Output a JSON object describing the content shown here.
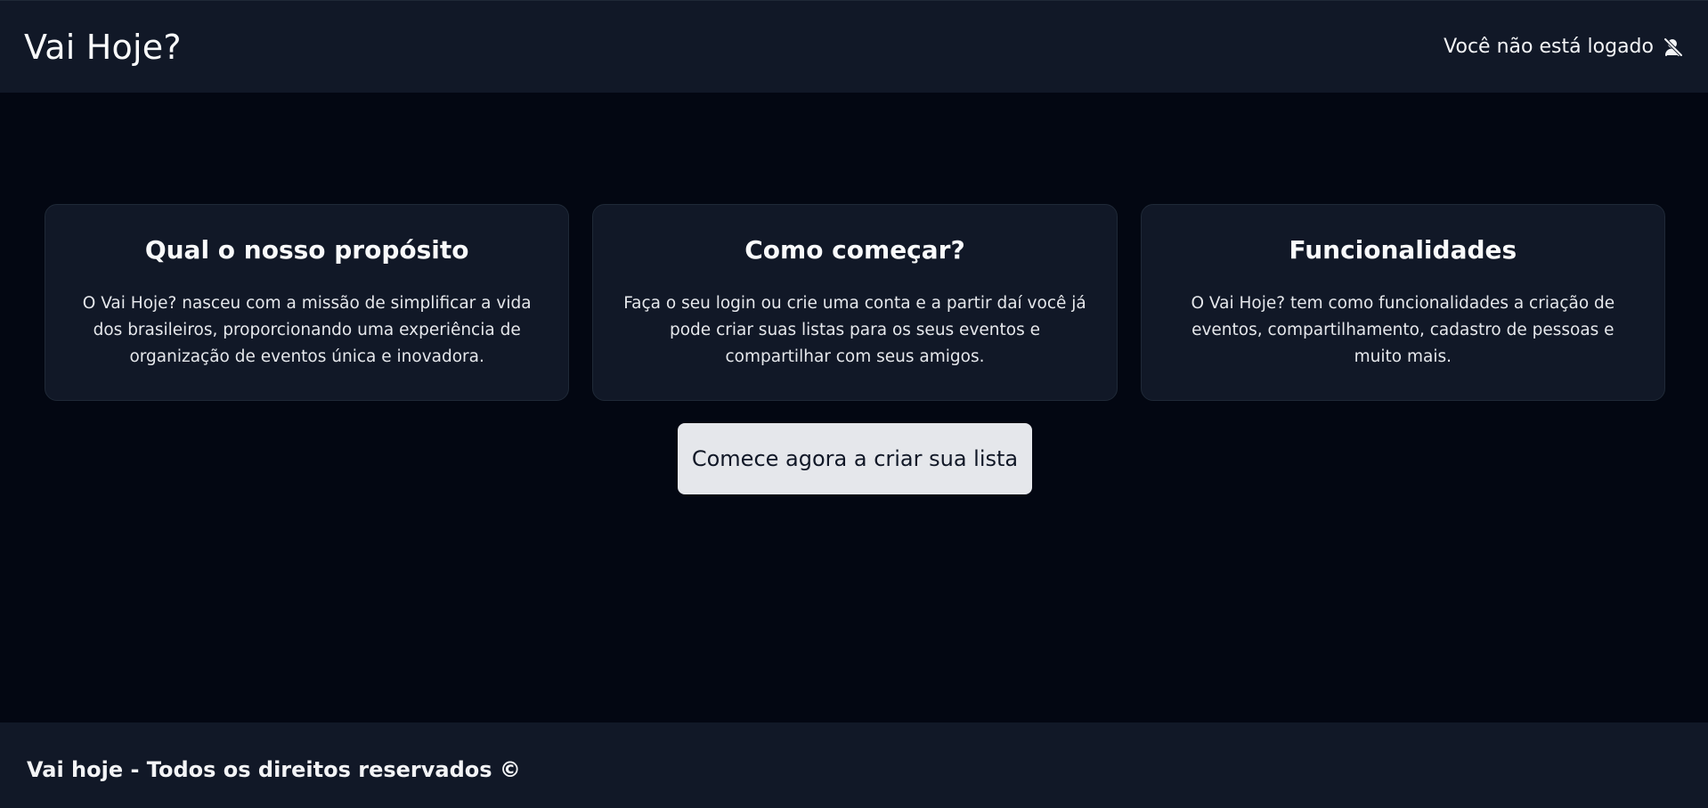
{
  "header": {
    "title": "Vai Hoje?",
    "auth_status": "Você não está logado",
    "auth_icon": "user-slash-icon"
  },
  "cards": [
    {
      "title": "Qual o nosso propósito",
      "text": "O Vai Hoje? nasceu com a missão de simplificar a vida dos brasileiros, proporcionando uma experiência de organização de eventos única e inovadora."
    },
    {
      "title": "Como começar?",
      "text": "Faça o seu login ou crie uma conta e a partir daí você já pode criar suas listas para os seus eventos e compartilhar com seus amigos."
    },
    {
      "title": "Funcionalidades",
      "text": "O Vai Hoje? tem como funcionalidades a criação de eventos, compartilhamento, cadastro de pessoas e muito mais."
    }
  ],
  "cta": {
    "label": "Comece agora a criar sua lista"
  },
  "footer": {
    "text": "Vai hoje - Todos os direitos reservados ©"
  },
  "colors": {
    "page_bg": "#030712",
    "panel_bg": "#111827",
    "button_bg": "#e5e7eb",
    "button_text": "#111827",
    "text": "#f9fafb"
  }
}
